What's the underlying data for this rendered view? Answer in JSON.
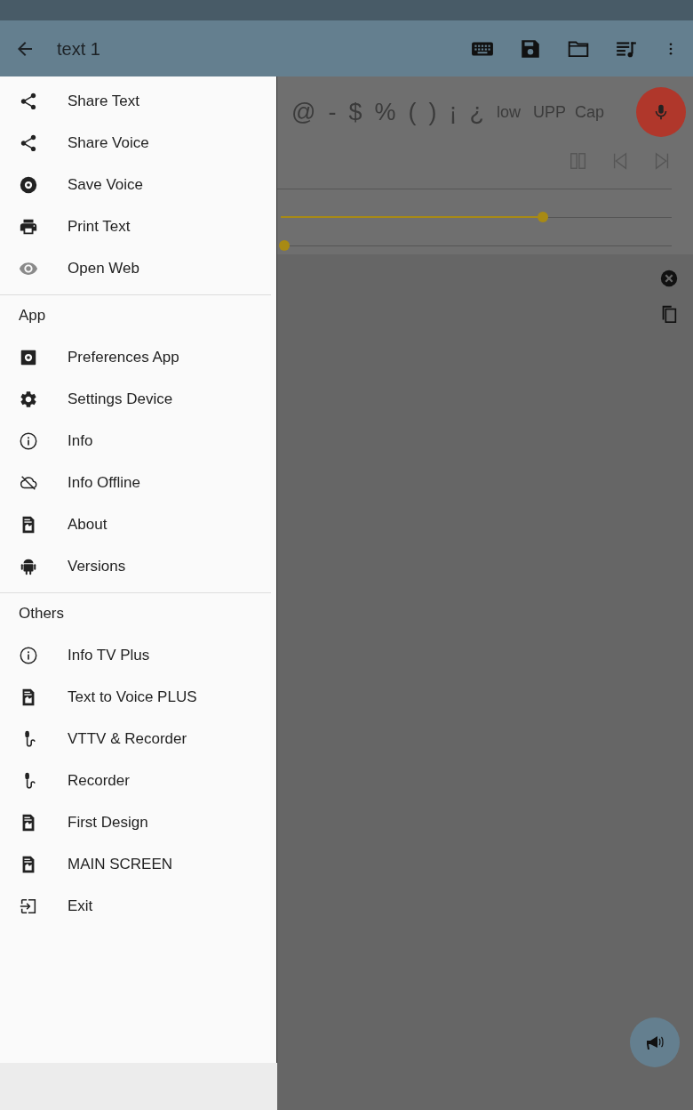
{
  "app_bar": {
    "title": "text 1"
  },
  "drawer": {
    "sections": [
      {
        "items": [
          {
            "label": "Share Text",
            "kind": "share"
          },
          {
            "label": "Share Voice",
            "kind": "share"
          },
          {
            "label": "Save Voice",
            "kind": "disc"
          },
          {
            "label": "Print Text",
            "kind": "print"
          },
          {
            "label": "Open Web",
            "kind": "eye"
          }
        ]
      },
      {
        "header": "App",
        "items": [
          {
            "label": "Preferences App",
            "kind": "prefs"
          },
          {
            "label": "Settings Device",
            "kind": "gear"
          },
          {
            "label": "Info",
            "kind": "info"
          },
          {
            "label": "Info Offline",
            "kind": "cloud"
          },
          {
            "label": "About",
            "kind": "doc"
          },
          {
            "label": "Versions",
            "kind": "android"
          }
        ]
      },
      {
        "header": "Others",
        "items": [
          {
            "label": "Info TV Plus",
            "kind": "info"
          },
          {
            "label": "Text to Voice PLUS",
            "kind": "doc"
          },
          {
            "label": "VTTV & Recorder",
            "kind": "mic"
          },
          {
            "label": "Recorder",
            "kind": "mic"
          },
          {
            "label": "First Design",
            "kind": "doc"
          },
          {
            "label": "MAIN SCREEN",
            "kind": "doc"
          },
          {
            "label": "Exit",
            "kind": "exit"
          }
        ]
      }
    ]
  },
  "symbols": [
    "@",
    "-",
    "$",
    "%",
    "(",
    ")",
    "¡",
    "¿",
    "low",
    "UPP",
    "Cap"
  ],
  "sliders": [
    {
      "level": 0.67
    },
    {
      "level": 0.01
    }
  ]
}
